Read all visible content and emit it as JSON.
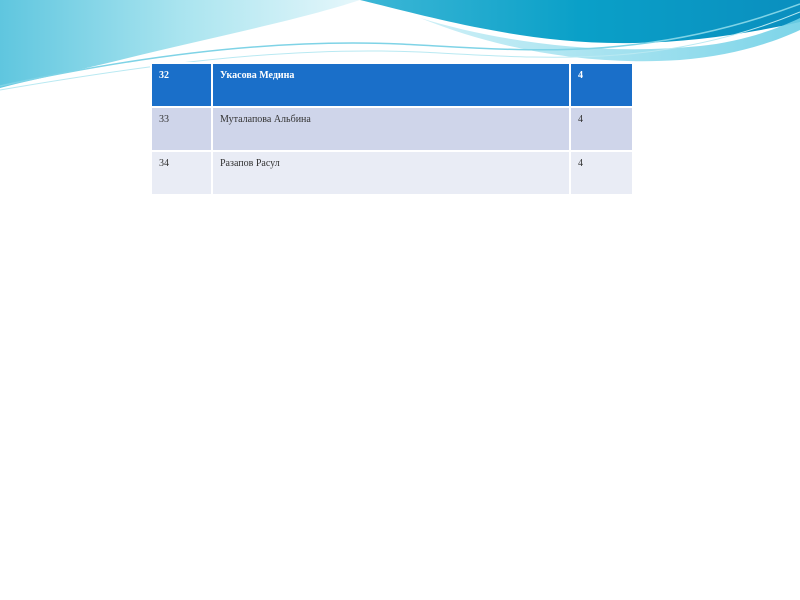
{
  "table": {
    "rows": [
      {
        "num": "32",
        "name": "Укасова Медина",
        "grade": "4"
      },
      {
        "num": "33",
        "name": "Муталапова Альбина",
        "grade": "4"
      },
      {
        "num": "34",
        "name": "Разапов Расул",
        "grade": "4"
      }
    ]
  },
  "colors": {
    "header_row": "#1a6fc9",
    "row_band_1": "#cfd5ea",
    "row_band_2": "#e9ecf5",
    "wave_dark": "#0a8fbf",
    "wave_light": "#9fe0ee"
  }
}
